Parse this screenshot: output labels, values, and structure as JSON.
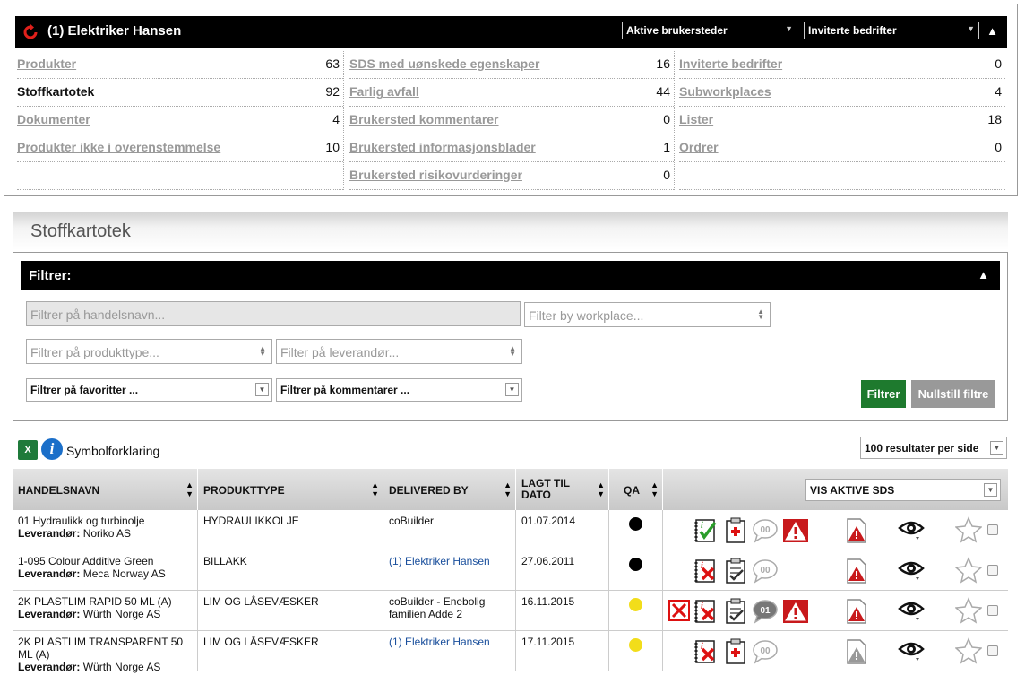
{
  "header": {
    "title": "(1) Elektriker Hansen",
    "select_left": "Aktive brukersteder",
    "select_right": "Inviterte bedrifter"
  },
  "stats": {
    "col1": [
      {
        "label": "Produkter",
        "value": "63",
        "link": true
      },
      {
        "label": "Stoffkartotek",
        "value": "92",
        "link": false
      },
      {
        "label": "Dokumenter",
        "value": "4",
        "link": true
      },
      {
        "label": "Produkter ikke i overenstemmelse",
        "value": "10",
        "link": true
      }
    ],
    "col2": [
      {
        "label": "SDS med uønskede egenskaper",
        "value": "16"
      },
      {
        "label": "Farlig avfall",
        "value": "44"
      },
      {
        "label": "Brukersted kommentarer",
        "value": "0"
      },
      {
        "label": "Brukersted informasjonsblader",
        "value": "1"
      },
      {
        "label": "Brukersted risikovurderinger",
        "value": "0"
      }
    ],
    "col3": [
      {
        "label": "Inviterte bedrifter",
        "value": "0"
      },
      {
        "label": "Subworkplaces",
        "value": "4"
      },
      {
        "label": "Lister",
        "value": "18"
      },
      {
        "label": "Ordrer",
        "value": "0"
      }
    ]
  },
  "section_title": "Stoffkartotek",
  "filter": {
    "title": "Filtrer:",
    "name_placeholder": "Filtrer på handelsnavn...",
    "workplace_placeholder": "Filter by workplace...",
    "producttype_placeholder": "Filtrer på produkttype...",
    "supplier_placeholder": "Filter på leverandør...",
    "favorites": "Filtrer på favoritter ...",
    "comments": "Filtrer på kommentarer ...",
    "apply_label": "Filtrer",
    "reset_label": "Nullstill filtre"
  },
  "legend": {
    "excel_icon": "excel-icon",
    "excel_label": "X",
    "info_label": "i",
    "label": "Symbolforklaring"
  },
  "per_page": "100 resultater per side",
  "table": {
    "columns": [
      "HANDELSNAVN",
      "PRODUKTTYPE",
      "DELIVERED BY",
      "LAGT TIL DATO",
      "QA"
    ],
    "sds_filter": "VIS AKTIVE SDS",
    "supplier_prefix": "Leverandør:",
    "rows": [
      {
        "name": "01 Hydraulikk og turbinolje",
        "supplier": "Noriko AS",
        "type": "HYDRAULIKKOLJE",
        "delivered": "coBuilder",
        "delivered_link": false,
        "date": "01.07.2014",
        "qa": "#000000",
        "comment_count": "00"
      },
      {
        "name": "1-095 Colour Additive Green",
        "supplier": "Meca Norway AS",
        "type": "BILLAKK",
        "delivered": "(1) Elektriker Hansen",
        "delivered_link": true,
        "date": "27.06.2011",
        "qa": "#000000",
        "comment_count": "00"
      },
      {
        "name": "2K PLASTLIM RAPID 50 ML (A)",
        "supplier": "Würth Norge AS",
        "type": "LIM OG LÅSEVÆSKER",
        "delivered": "coBuilder - Enebolig familien Adde 2",
        "delivered_link": false,
        "date": "16.11.2015",
        "qa": "#f2dd1a",
        "comment_count": "01"
      },
      {
        "name": "2K PLASTLIM TRANSPARENT 50 ML (A)",
        "supplier": "Würth Norge AS",
        "type": "LIM OG LÅSEVÆSKER",
        "delivered": "(1) Elektriker Hansen",
        "delivered_link": true,
        "date": "17.11.2015",
        "qa": "#f2dd1a",
        "comment_count": "00"
      }
    ]
  },
  "colors": {
    "accent_green": "#1e7a2e",
    "link_grey": "#999999",
    "link_blue": "#1a4f9c",
    "warning_red": "#cc0000"
  }
}
